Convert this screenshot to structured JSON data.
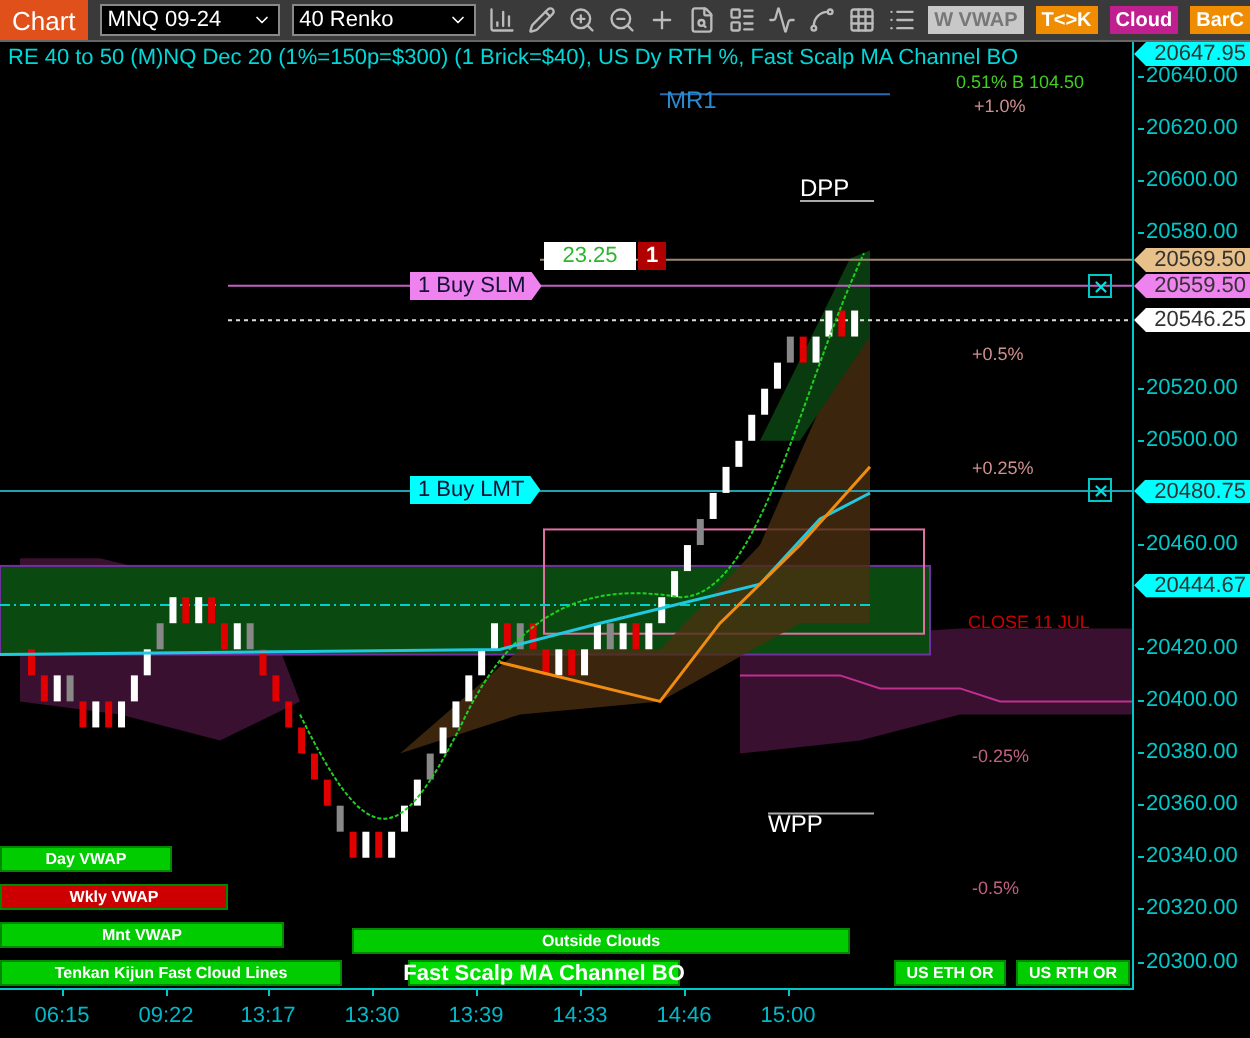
{
  "chart_tab": {
    "label": "Chart"
  },
  "toolbar": {
    "instrument": "MNQ 09-24",
    "bar_type": "40 Renko",
    "buttons": [
      {
        "label": "W VWAP",
        "color": "#c8c8c8"
      },
      {
        "label": "T<>K",
        "color": "#f08c00"
      },
      {
        "label": "Cloud",
        "color": "#c0208f"
      },
      {
        "label": "BarC",
        "color": "#f08c00"
      }
    ]
  },
  "chart": {
    "title": "RE 40 to 50 (M)NQ Dec 20 (1%=150p=$300) (1 Brick=$40), US Dy RTH %, Fast Scalp MA Channel BO",
    "labels": [
      {
        "text": "0.51% B 104.50",
        "color": "#40d020"
      },
      {
        "text": "+1.0%",
        "color": "#d09090"
      },
      {
        "text": "MR1",
        "color": "#2a8ad0"
      },
      {
        "text": "DPP",
        "color": "#ffffff"
      },
      {
        "text": "+0.5%",
        "color": "#d09090"
      },
      {
        "text": "+0.25%",
        "color": "#d09090"
      },
      {
        "text": "CLOSE 11 JUL",
        "color": "#cc0000"
      },
      {
        "text": "-0.25%",
        "color": "#c06080"
      },
      {
        "text": "WPP",
        "color": "#ffffff"
      },
      {
        "text": "-0.5%",
        "color": "#c06080"
      }
    ],
    "position": {
      "pnl": "23.25",
      "quantity": "1"
    },
    "orders": [
      {
        "label": "1 Buy SLM",
        "color": "#ee82ee"
      },
      {
        "label": "1 Buy LMT",
        "color": "#00ffff"
      }
    ],
    "indicators": [
      {
        "label": "Day VWAP",
        "color": "#00cc00"
      },
      {
        "label": "Wkly VWAP",
        "color": "#cc0000"
      },
      {
        "label": "Mnt VWAP",
        "color": "#00cc00"
      },
      {
        "label": "Tenkan Kijun Fast Cloud Lines",
        "color": "#00cc00"
      },
      {
        "label": "Outside Clouds",
        "color": "#00cc00"
      },
      {
        "label": "Fast Scalp MA Channel BO",
        "color": "#00dd00"
      },
      {
        "label": "US ETH OR",
        "color": "#00cc00"
      },
      {
        "label": "US RTH OR",
        "color": "#00cc00"
      }
    ]
  },
  "price_axis": {
    "ticks": [
      "20640.00",
      "20620.00",
      "20600.00",
      "20580.00",
      "20520.00",
      "20500.00",
      "20460.00",
      "20420.00",
      "20400.00",
      "20380.00",
      "20360.00",
      "20340.00",
      "20320.00",
      "20300.00"
    ],
    "flags": [
      {
        "text": "20647.95",
        "color": "#00ffff"
      },
      {
        "text": "20569.50",
        "color": "#e8c08a"
      },
      {
        "text": "20559.50",
        "color": "#ee82ee"
      },
      {
        "text": "20546.25",
        "color": "#ffffff"
      },
      {
        "text": "20480.75",
        "color": "#00ffff"
      },
      {
        "text": "20444.67",
        "color": "#00ffff"
      }
    ]
  },
  "time_axis": {
    "ticks": [
      "06:15",
      "09:22",
      "13:17",
      "13:30",
      "13:39",
      "14:33",
      "14:46",
      "15:00"
    ]
  }
}
